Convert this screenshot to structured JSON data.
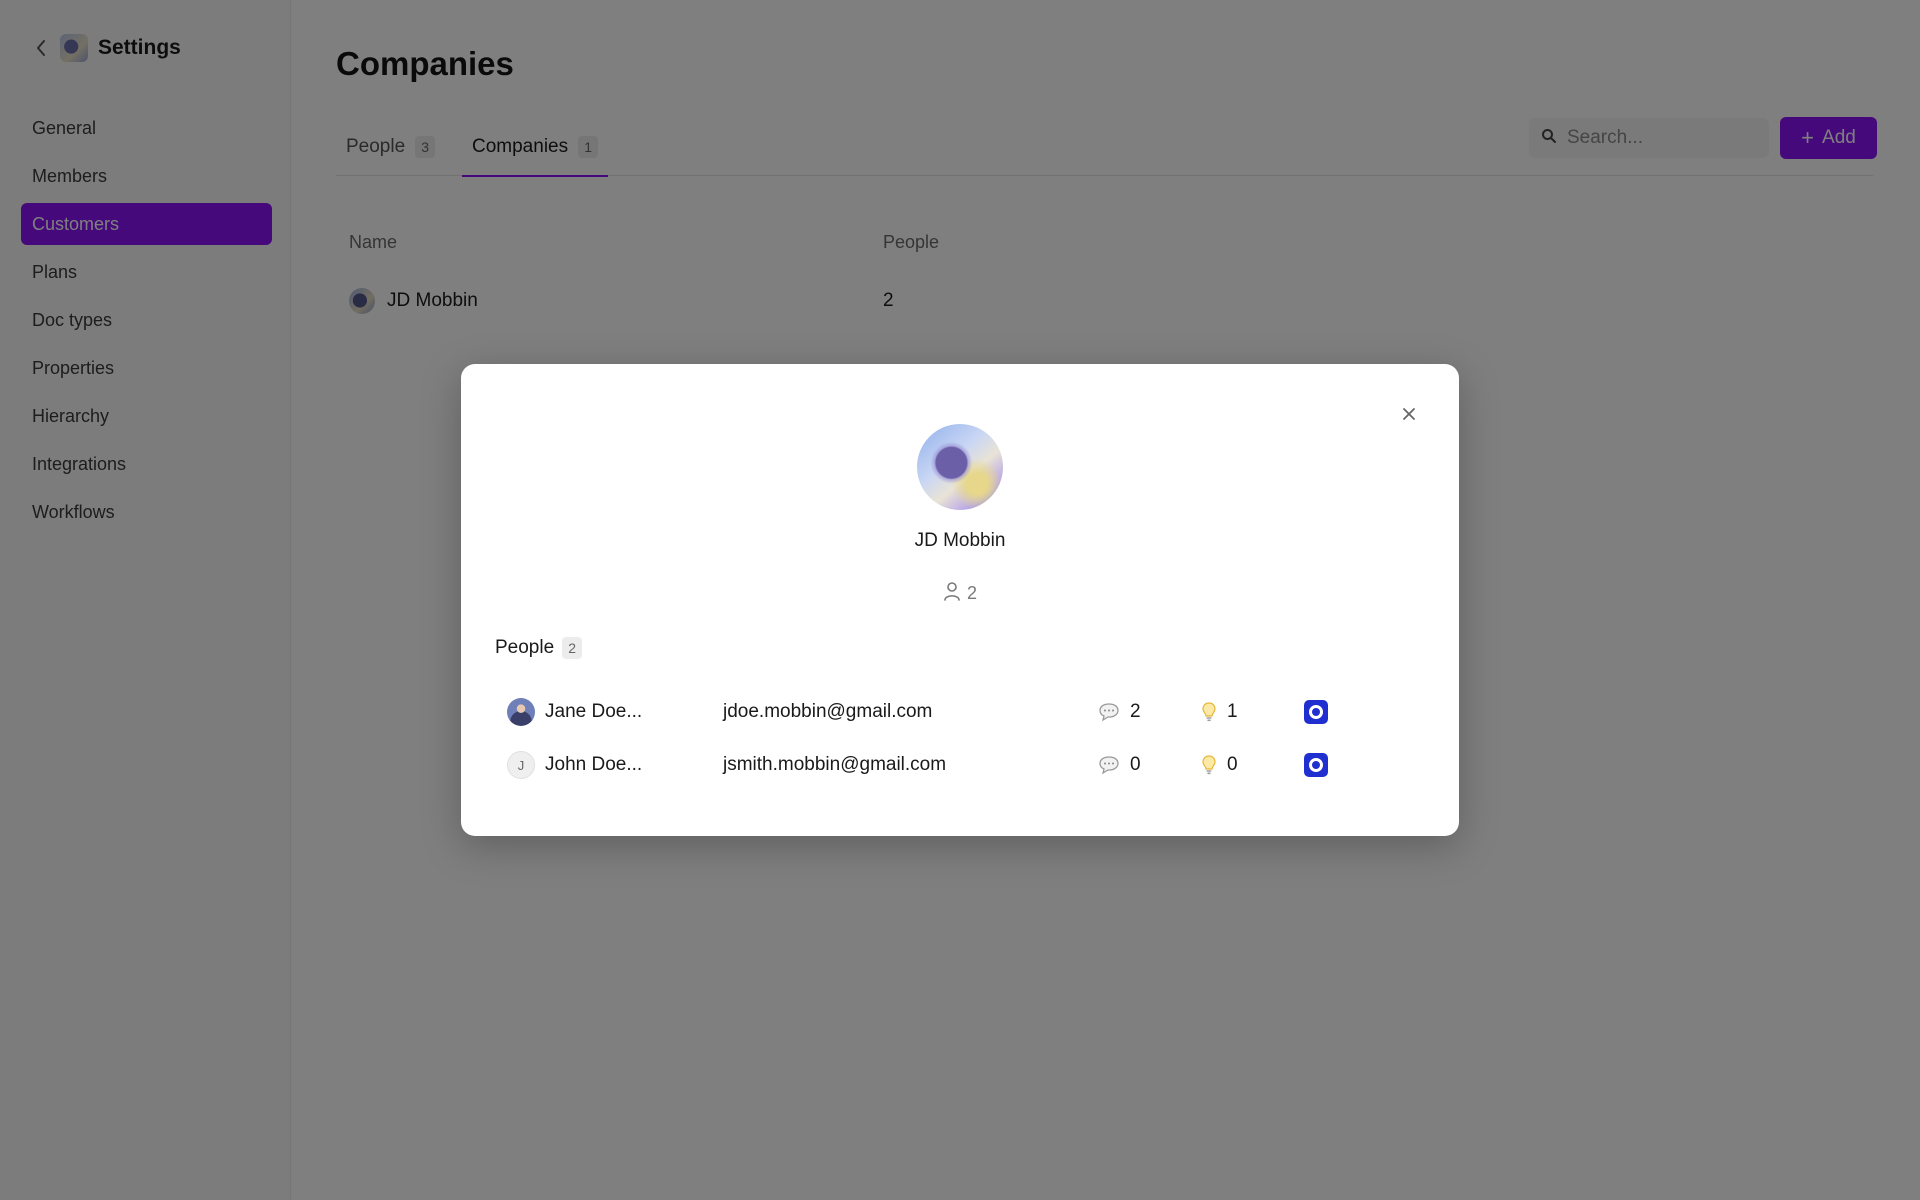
{
  "sidebar": {
    "title": "Settings",
    "items": [
      {
        "label": "General"
      },
      {
        "label": "Members"
      },
      {
        "label": "Customers",
        "active": true
      },
      {
        "label": "Plans"
      },
      {
        "label": "Doc types"
      },
      {
        "label": "Properties"
      },
      {
        "label": "Hierarchy"
      },
      {
        "label": "Integrations"
      },
      {
        "label": "Workflows"
      }
    ]
  },
  "page": {
    "title": "Companies",
    "tabs": [
      {
        "label": "People",
        "count": "3"
      },
      {
        "label": "Companies",
        "count": "1",
        "active": true
      }
    ],
    "search": {
      "placeholder": "Search..."
    },
    "add_label": "Add",
    "table": {
      "columns": [
        "Name",
        "People"
      ],
      "rows": [
        {
          "name": "JD Mobbin",
          "people": "2"
        }
      ]
    }
  },
  "modal": {
    "company_name": "JD Mobbin",
    "people_count": "2",
    "section_label": "People",
    "section_count": "2",
    "people": [
      {
        "name": "Jane Doe...",
        "email": "jdoe.mobbin@gmail.com",
        "comments": "2",
        "ideas": "1",
        "avatar": "photo"
      },
      {
        "name": "John Doe...",
        "email": "jsmith.mobbin@gmail.com",
        "comments": "0",
        "ideas": "0",
        "avatar": "initial",
        "initial": "J"
      }
    ]
  },
  "colors": {
    "accent": "#8a12f6",
    "chip": "#1f2fd0",
    "overlay": "rgba(0,0,0,0.5)"
  }
}
